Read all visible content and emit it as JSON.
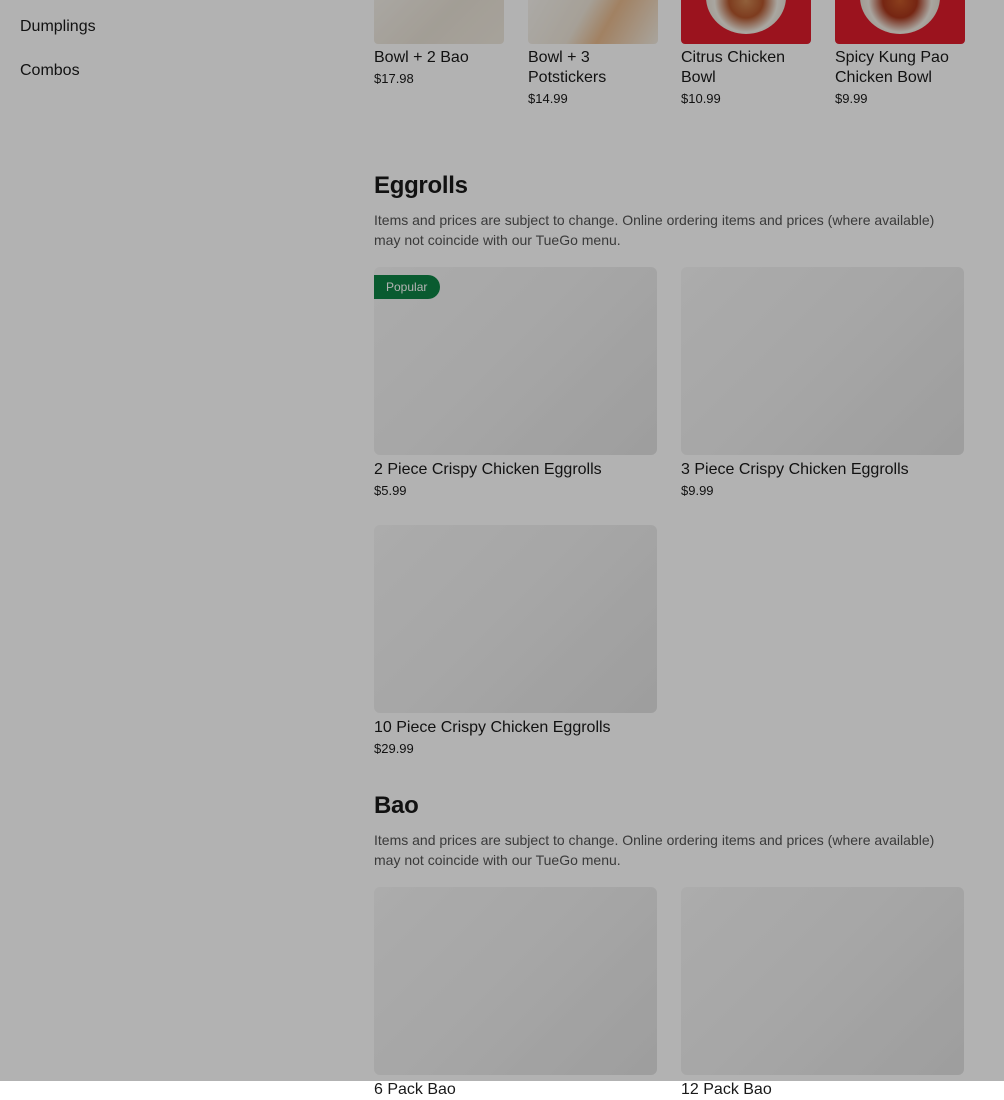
{
  "sidebar": {
    "items": [
      {
        "label": "Dumplings"
      },
      {
        "label": "Combos"
      }
    ]
  },
  "top_row": {
    "items": [
      {
        "name": "Bowl + 2 Bao",
        "price": "$17.98"
      },
      {
        "name": "Bowl + 3 Potstickers",
        "price": "$14.99"
      },
      {
        "name": "Citrus Chicken Bowl",
        "price": "$10.99"
      },
      {
        "name": "Spicy Kung Pao Chicken Bowl",
        "price": "$9.99"
      }
    ]
  },
  "sections": [
    {
      "title": "Eggrolls",
      "description": "Items and prices are subject to change. Online ordering items and prices (where available) may not coincide with our TueGo menu.",
      "items": [
        {
          "name": "2 Piece Crispy Chicken Eggrolls",
          "price": "$5.99",
          "badge": "Popular"
        },
        {
          "name": "3 Piece Crispy Chicken Eggrolls",
          "price": "$9.99"
        },
        {
          "name": "10 Piece Crispy Chicken Eggrolls",
          "price": "$29.99"
        }
      ]
    },
    {
      "title": "Bao",
      "description": "Items and prices are subject to change. Online ordering items and prices (where available) may not coincide with our TueGo menu.",
      "items": [
        {
          "name": "6 Pack Bao"
        },
        {
          "name": "12 Pack Bao"
        }
      ]
    }
  ],
  "colors": {
    "badge_green": "#0e8345",
    "brand_red": "#de1c2b",
    "overlay": "rgba(0,0,0,0.3)"
  }
}
